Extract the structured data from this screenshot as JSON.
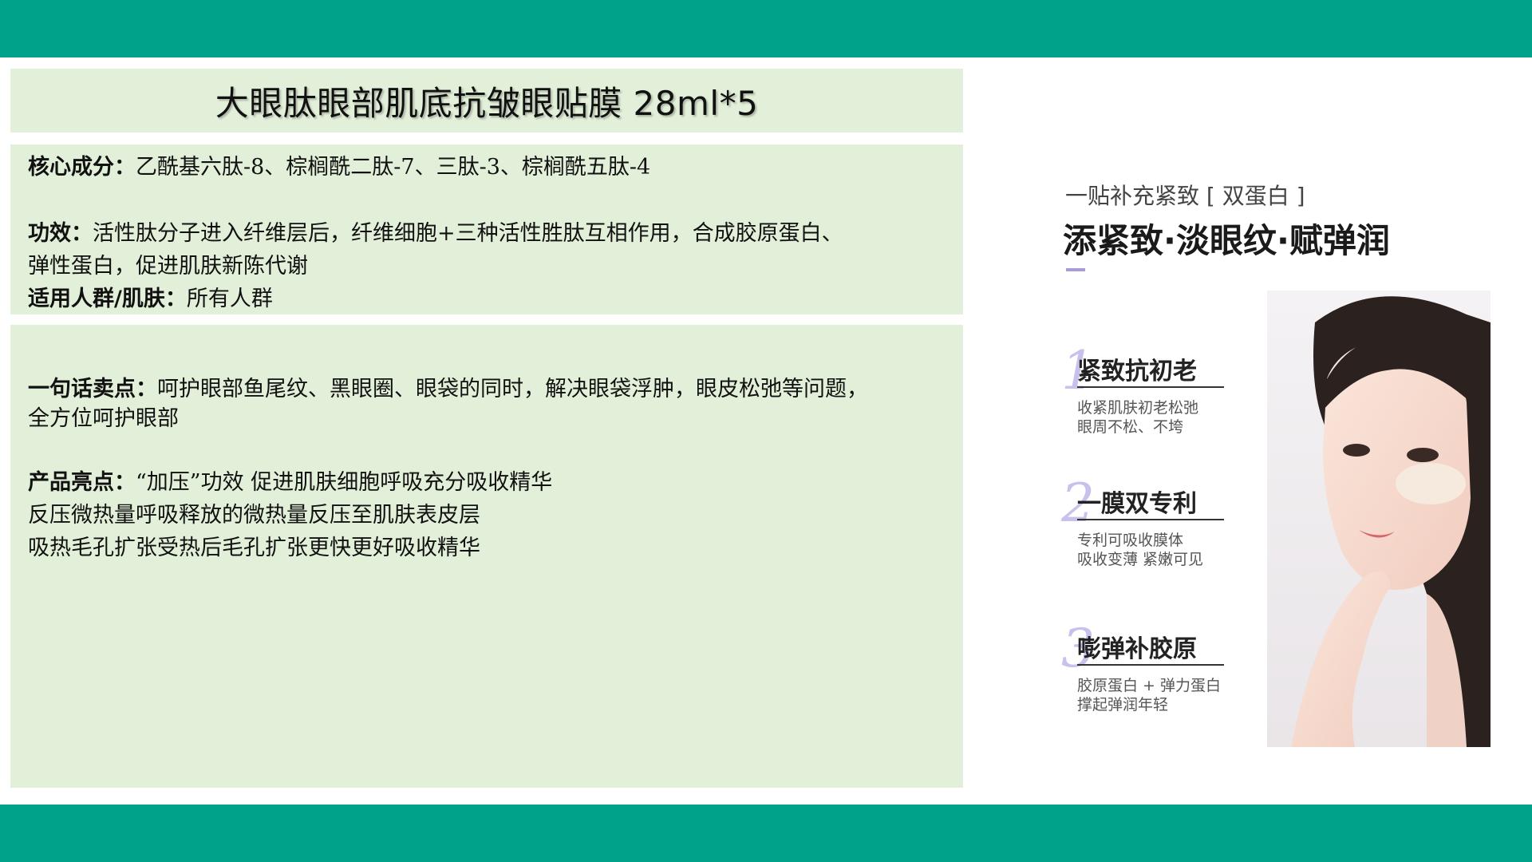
{
  "title": "大眼肽眼部肌底抗皱眼贴膜 28ml*5",
  "info": {
    "ingredients_label": "核心成分：",
    "ingredients_text": "乙酰基六肽-8、棕榈酰二肽-7、三肽-3、棕榈酰五肽-4",
    "efficacy_label": "功效：",
    "efficacy_text_1": "活性肽分子进入纤维层后，纤维细胞+三种活性胜肽互相作用，合成胶原蛋白、",
    "efficacy_text_2": "弹性蛋白，促进肌肤新陈代谢",
    "audience_label": "适用人群/肌肤：",
    "audience_text": "所有人群"
  },
  "selling": {
    "pitch_label": "一句话卖点：",
    "pitch_text_1": "呵护眼部鱼尾纹、黑眼圈、眼袋的同时，解决眼袋浮肿，眼皮松弛等问题，",
    "pitch_text_2": "全方位呵护眼部",
    "highlights_label": "产品亮点：",
    "highlights_text_1": "“加压”功效 促进肌肤细胞呼吸充分吸收精华",
    "highlights_text_2": "反压微热量呼吸释放的微热量反压至肌肤表皮层",
    "highlights_text_3": "吸热毛孔扩张受热后毛孔扩张更快更好吸收精华"
  },
  "visual": {
    "subtitle": "一贴补充紧致 [ 双蛋白 ]",
    "headline": "添紧致·淡眼纹·赋弹润",
    "features": [
      {
        "num": "1",
        "title": "紧致抗初老",
        "desc1": "收紧肌肤初老松弛",
        "desc2": "眼周不松、不垮"
      },
      {
        "num": "2",
        "title": "一膜双专利",
        "desc1": "专利可吸收膜体",
        "desc2": "吸收变薄 紧嫩可见"
      },
      {
        "num": "3",
        "title": "嘭弹补胶原",
        "desc1": "胶原蛋白 + 弹力蛋白",
        "desc2": "撑起弹润年轻"
      }
    ]
  },
  "colors": {
    "band": "#00a38a",
    "panel": "#e2efd9",
    "accent_purple": "#c9c1ec"
  }
}
